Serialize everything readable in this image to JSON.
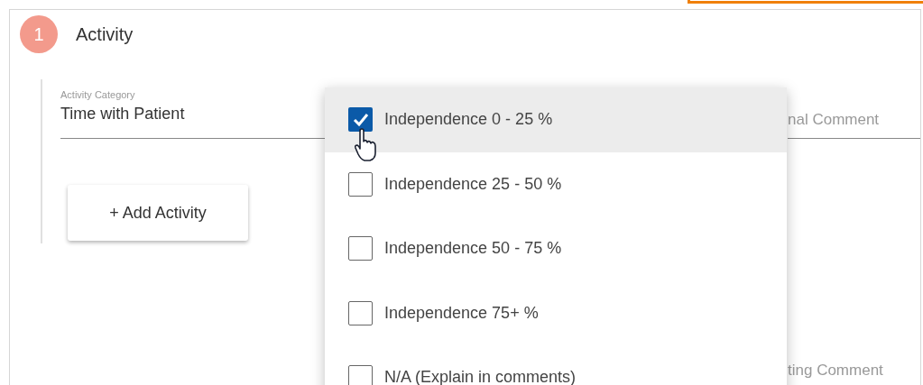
{
  "step": {
    "number": "1",
    "title": "Activity"
  },
  "activity_category": {
    "label": "Activity Category",
    "value": "Time with Patient"
  },
  "add_button": "+ Add Activity",
  "comment_fields": [
    {
      "placeholder": "nal Comment"
    },
    {
      "placeholder": "ting Comment"
    }
  ],
  "options": [
    {
      "label": "Independence 0 - 25 %",
      "checked": true,
      "highlighted": true
    },
    {
      "label": "Independence 25 - 50 %",
      "checked": false,
      "highlighted": false
    },
    {
      "label": "Independence 50 - 75 %",
      "checked": false,
      "highlighted": false
    },
    {
      "label": "Independence 75+ %",
      "checked": false,
      "highlighted": false
    },
    {
      "label": "N/A (Explain in comments)",
      "checked": false,
      "highlighted": false
    }
  ]
}
